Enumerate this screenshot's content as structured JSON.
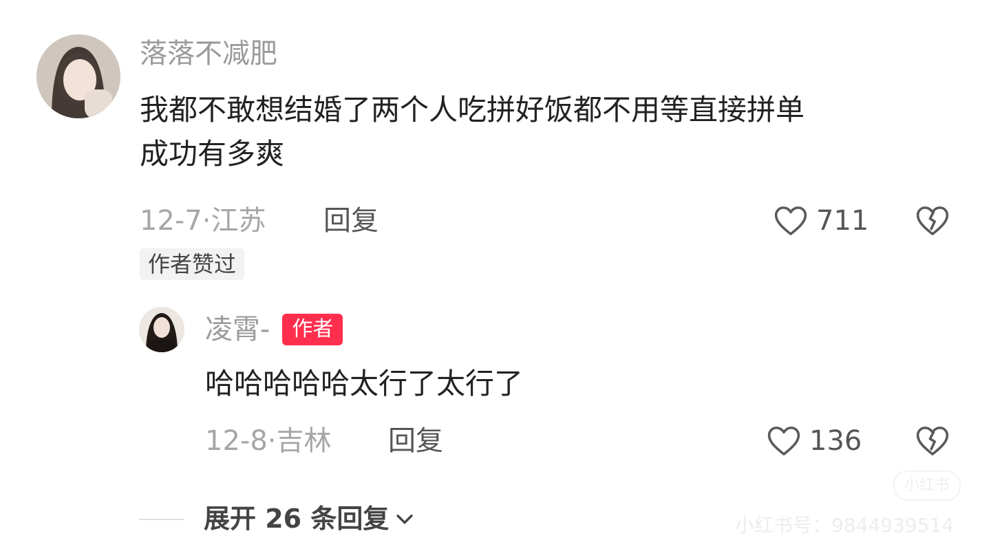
{
  "comment": {
    "username": "落落不减肥",
    "content_line1": "我都不敢想结婚了两个人吃拼好饭都不用等直接拼单",
    "content_line2": "成功有多爽",
    "date": "12-7",
    "location": "江苏",
    "reply_label": "回复",
    "likes": "711",
    "liked_badge": "作者赞过"
  },
  "reply": {
    "username": "凌霄-",
    "author_badge": "作者",
    "content": "哈哈哈哈哈太行了太行了",
    "date": "12-8",
    "location": "吉林",
    "reply_label": "回复",
    "likes": "136"
  },
  "expand": {
    "label": "展开 26 条回复"
  },
  "watermark": {
    "id_text": "小红书号：9844939514",
    "logo_text": "小红书"
  },
  "icons": {
    "like": "heart-outline-icon",
    "dislike": "broken-heart-icon",
    "expand": "chevron-down-icon"
  }
}
